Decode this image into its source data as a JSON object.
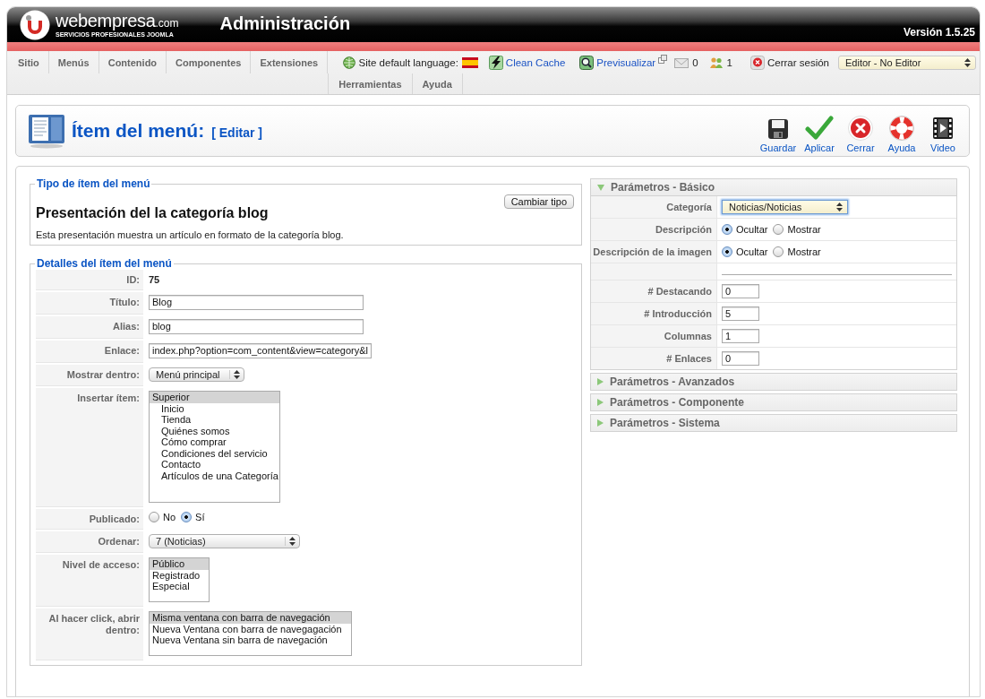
{
  "header": {
    "logo": {
      "name": "webempresa",
      "domain": ".com",
      "tagline": "SERVICIOS PROFESIONALES JOOMLA"
    },
    "title": "Administración",
    "version": "Versión 1.5.25"
  },
  "menu": {
    "rows": [
      {
        "items": [
          {
            "label": "Sitio"
          },
          {
            "label": "Menús"
          },
          {
            "label": "Contenido"
          },
          {
            "label": "Componentes"
          },
          {
            "label": "Extensiones"
          }
        ]
      },
      {
        "items": [
          {
            "label": "Herramientas"
          },
          {
            "label": "Ayuda"
          }
        ]
      }
    ]
  },
  "status": {
    "language_label": "Site default language:",
    "clean_cache": "Clean Cache",
    "preview": "Previsualizar",
    "messages": "0",
    "users_online": "1",
    "logout": "Cerrar sesión",
    "editor_select": "Editor - No Editor"
  },
  "page_title": {
    "title": "Ítem del menú:",
    "action": "[ Editar ]"
  },
  "toolbar": [
    {
      "kind": "save",
      "label": "Guardar"
    },
    {
      "kind": "apply",
      "label": "Aplicar"
    },
    {
      "kind": "close",
      "label": "Cerrar"
    },
    {
      "kind": "help",
      "label": "Ayuda"
    },
    {
      "kind": "video",
      "label": "Video"
    }
  ],
  "type_fieldset": {
    "legend": "Tipo de ítem del menú",
    "button": "Cambiar tipo",
    "heading": "Presentación del la categoría blog",
    "description": "Esta presentación muestra un artículo en formato de la categoría blog."
  },
  "details": {
    "legend": "Detalles del ítem del menú",
    "rows": [
      {
        "kind": "text",
        "label": "ID:",
        "value": "75"
      },
      {
        "kind": "input",
        "label": "Título:",
        "value": "Blog"
      },
      {
        "kind": "input",
        "label": "Alias:",
        "value": "blog"
      },
      {
        "kind": "input",
        "label": "Enlace:",
        "value": "index.php?option=com_content&view=category&l"
      },
      {
        "kind": "select",
        "label": "Mostrar dentro:",
        "value": "Menú principal"
      },
      {
        "kind": "tree_list",
        "label": "Insertar ítem:",
        "options": [
          {
            "label": "Superior",
            "selected": true,
            "children": [
              {
                "label": "Inicio",
                "selected": false
              },
              {
                "label": "Tienda",
                "selected": false
              },
              {
                "label": "Quiénes somos",
                "selected": false
              },
              {
                "label": "Cómo comprar",
                "selected": false
              },
              {
                "label": "Condiciones del servicio",
                "selected": false
              },
              {
                "label": "Contacto",
                "selected": false
              },
              {
                "label": "Artículos de una Categoría",
                "selected": false
              }
            ]
          }
        ]
      },
      {
        "kind": "radio",
        "label": "Publicado:",
        "options": [
          {
            "label": "No",
            "selected": false
          },
          {
            "label": "Sí",
            "selected": true
          }
        ]
      },
      {
        "kind": "select",
        "label": "Ordenar:",
        "value": "7 (Noticias)"
      },
      {
        "kind": "list",
        "label": "Nivel de acceso:",
        "options": [
          {
            "label": "Público",
            "selected": true
          },
          {
            "label": "Registrado",
            "selected": false
          },
          {
            "label": "Especial",
            "selected": false
          }
        ]
      },
      {
        "kind": "list",
        "label": "Al hacer click, abrir dentro:",
        "options": [
          {
            "label": "Misma ventana con barra de navegación",
            "selected": true
          },
          {
            "label": "Nueva Ventana con barra de navegagación",
            "selected": false
          },
          {
            "label": "Nueva Ventana sin barra de navegación",
            "selected": false
          }
        ]
      }
    ]
  },
  "parameters": [
    {
      "title": "Parámetros - Básico",
      "expanded": true,
      "rows": [
        {
          "kind": "select",
          "label": "Categoría",
          "value": "Noticias/Noticias",
          "focused": true
        },
        {
          "kind": "radio",
          "label": "Descripción",
          "options": [
            {
              "label": "Ocultar",
              "selected": true
            },
            {
              "label": "Mostrar",
              "selected": false
            }
          ]
        },
        {
          "kind": "radio",
          "label": "Descripción de la imagen",
          "options": [
            {
              "label": "Ocultar",
              "selected": true
            },
            {
              "label": "Mostrar",
              "selected": false
            }
          ]
        },
        {
          "kind": "separator"
        },
        {
          "kind": "input",
          "label": "# Destacando",
          "value": "0"
        },
        {
          "kind": "input",
          "label": "# Introducción",
          "value": "5"
        },
        {
          "kind": "input",
          "label": "Columnas",
          "value": "1"
        },
        {
          "kind": "input",
          "label": "# Enlaces",
          "value": "0"
        }
      ]
    },
    {
      "title": "Parámetros - Avanzados",
      "expanded": false
    },
    {
      "title": "Parámetros - Componente",
      "expanded": false
    },
    {
      "title": "Parámetros - Sistema",
      "expanded": false
    }
  ]
}
